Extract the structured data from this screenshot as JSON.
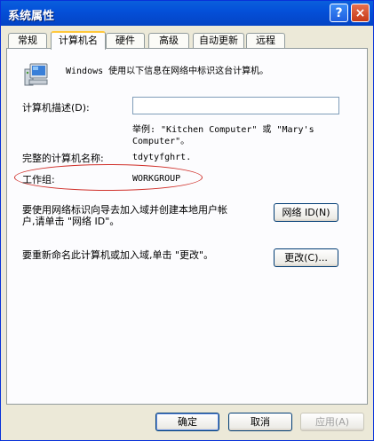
{
  "window": {
    "title": "系统属性",
    "help_glyph": "?",
    "close_glyph": "×"
  },
  "tabs": [
    {
      "label": "常规"
    },
    {
      "label": "计算机名"
    },
    {
      "label": "硬件"
    },
    {
      "label": "高级"
    },
    {
      "label": "自动更新"
    },
    {
      "label": "远程"
    }
  ],
  "panel": {
    "intro": "Windows 使用以下信息在网络中标识这台计算机。",
    "description_label": "计算机描述(D):",
    "description_value": "",
    "example_line1": "举例: \"Kitchen Computer\" 或 \"Mary's",
    "example_line2": "Computer\"。",
    "fullname_label": "完整的计算机名称:",
    "fullname_value": "tdytyfghrt.",
    "workgroup_label": "工作组:",
    "workgroup_value": "WORKGROUP",
    "network_id_text_line1": "要使用网络标识向导去加入域并创建本地用户帐",
    "network_id_text_line2": "户,请单击 \"网络 ID\"。",
    "network_id_button": "网络 ID(N)",
    "rename_text": "要重新命名此计算机或加入域,单击 \"更改\"。",
    "change_button": "更改(C)..."
  },
  "footer": {
    "ok": "确定",
    "cancel": "取消",
    "apply": "应用(A)"
  },
  "colors": {
    "titlebar": "#0450d9",
    "highlight_ellipse": "#d0302a",
    "tab_active_accent": "#ffc83c"
  }
}
